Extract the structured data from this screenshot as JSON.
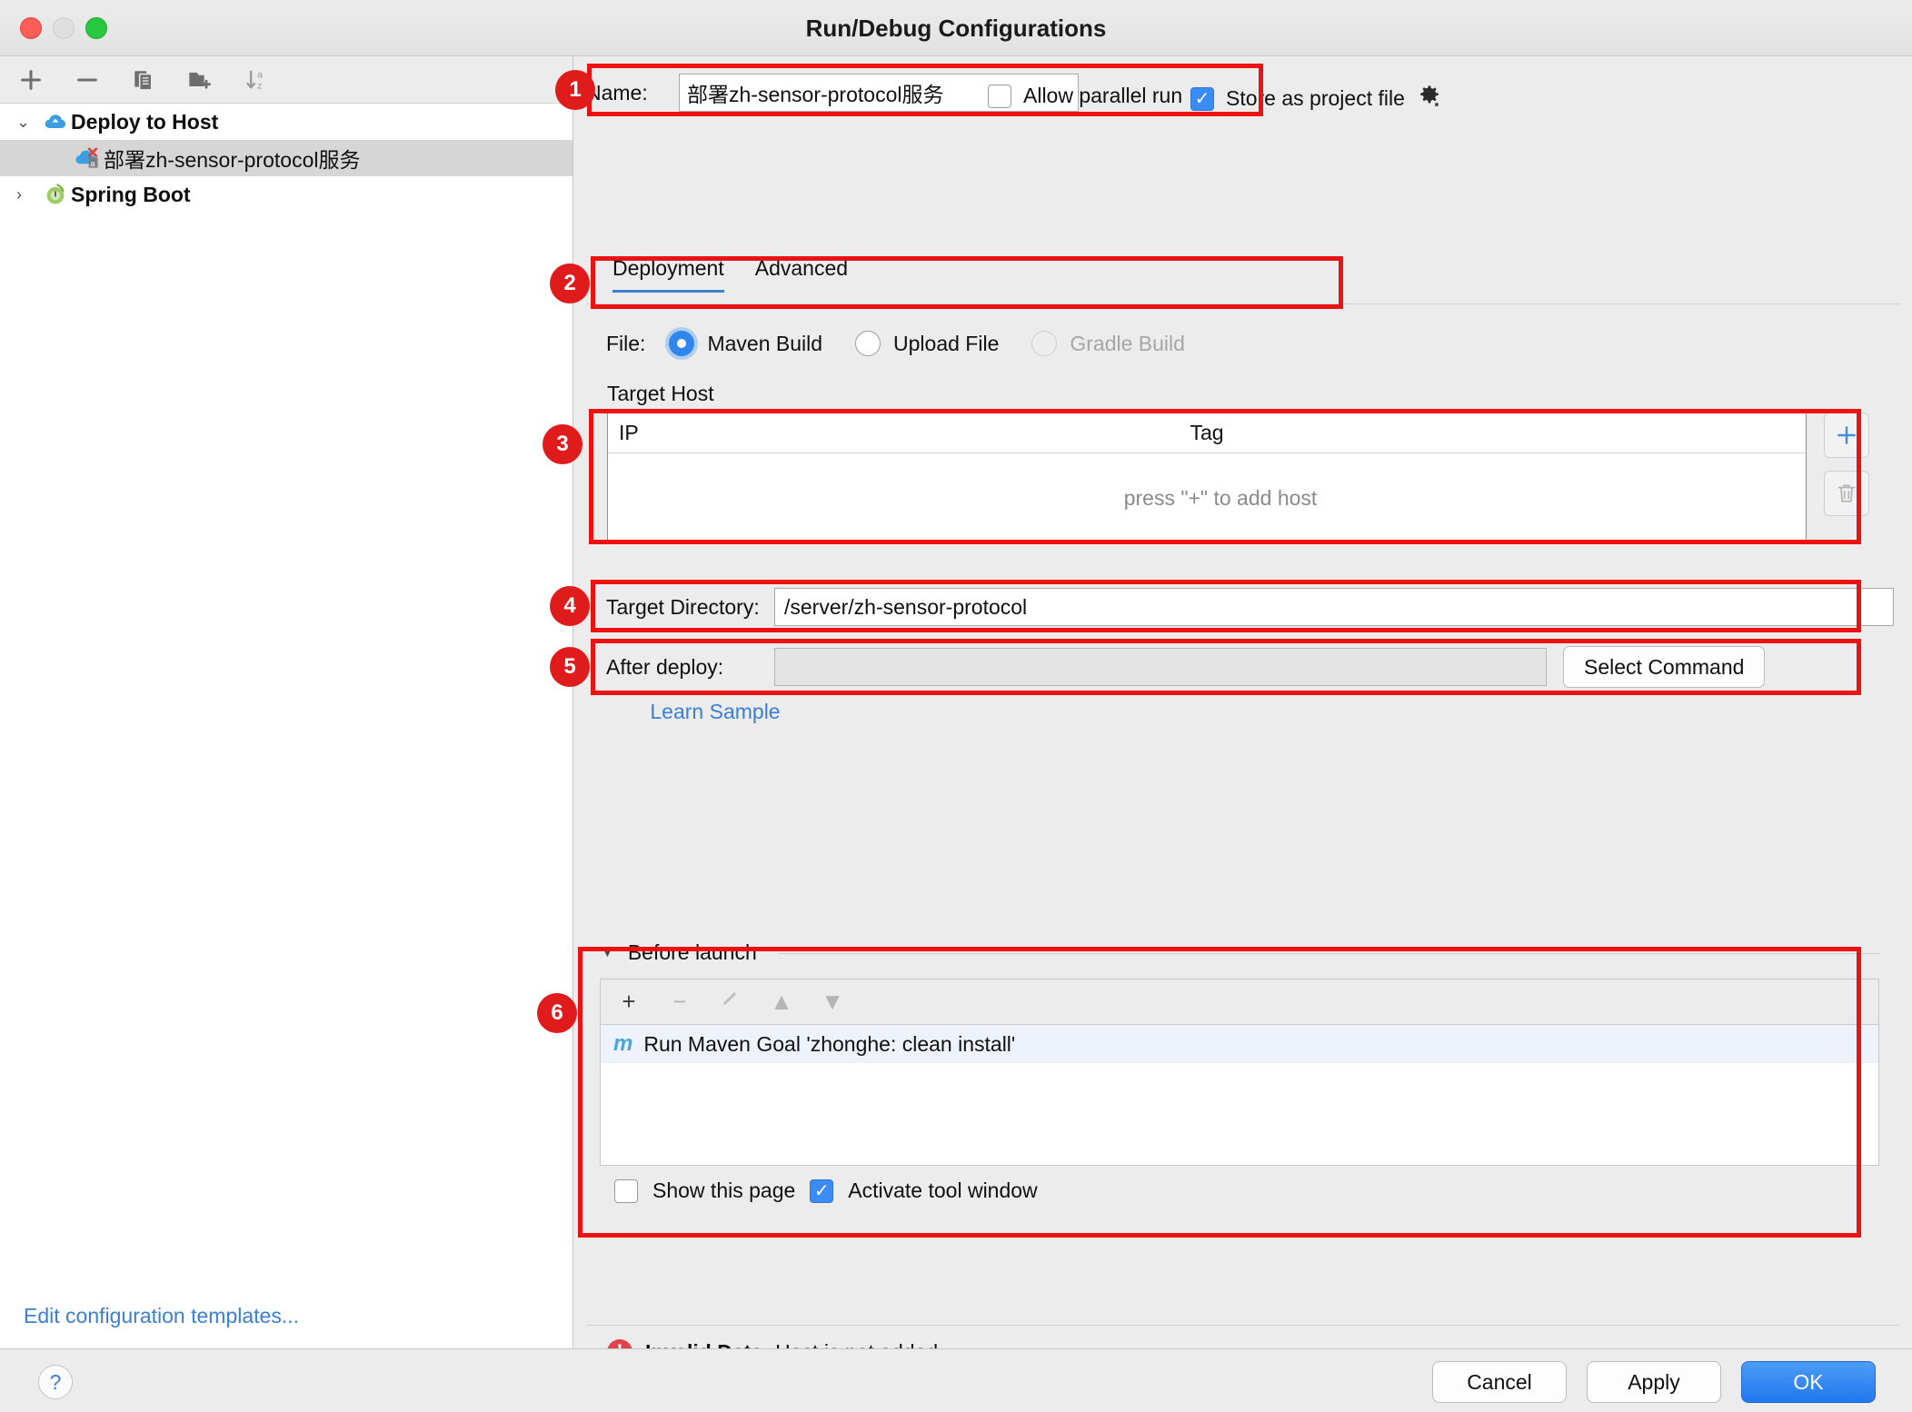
{
  "window": {
    "title": "Run/Debug Configurations",
    "traffic_lights": [
      "close",
      "minimize",
      "zoom"
    ]
  },
  "sidebar": {
    "toolbar": [
      {
        "name": "add-configuration-icon",
        "glyph": "+"
      },
      {
        "name": "remove-configuration-icon",
        "glyph": "−"
      },
      {
        "name": "copy-configuration-icon",
        "glyph": "copy"
      },
      {
        "name": "new-folder-icon",
        "glyph": "folder-plus"
      },
      {
        "name": "sort-alphabetically-icon",
        "glyph": "↓az"
      }
    ],
    "tree": [
      {
        "label": "Deploy to Host",
        "arrow": "⌄",
        "icon": "cloud-icon",
        "selected": false,
        "child": false
      },
      {
        "label": "部署zh-sensor-protocol服务",
        "arrow": "",
        "icon": "deploy-config-icon",
        "selected": true,
        "child": true
      },
      {
        "label": "Spring Boot",
        "arrow": "›",
        "icon": "spring-boot-icon",
        "selected": false,
        "child": false
      }
    ],
    "edit_templates_link": "Edit configuration templates..."
  },
  "form": {
    "name_label": "Name:",
    "name_value": "部署zh-sensor-protocol服务",
    "allow_parallel_run": {
      "label": "Allow parallel run",
      "checked": false
    },
    "store_as_project_file": {
      "label": "Store as project file",
      "checked": true,
      "gear_icon": "gear-icon"
    },
    "tabs": [
      {
        "label": "Deployment",
        "active": true
      },
      {
        "label": "Advanced",
        "active": false
      }
    ],
    "file_row": {
      "label": "File:",
      "options": [
        {
          "label": "Maven Build",
          "selected": true,
          "disabled": false
        },
        {
          "label": "Upload File",
          "selected": false,
          "disabled": false
        },
        {
          "label": "Gradle Build",
          "selected": false,
          "disabled": true
        }
      ]
    },
    "target_host": {
      "section_label": "Target Host",
      "columns": [
        "IP",
        "Tag"
      ],
      "rows": [],
      "empty_text": "press \"+\" to add host",
      "add_button": "+",
      "delete_button": "trash"
    },
    "target_directory": {
      "label": "Target Directory:",
      "value": "/server/zh-sensor-protocol"
    },
    "after_deploy": {
      "label": "After deploy:",
      "value": "",
      "select_command_button": "Select Command"
    },
    "learn_sample_link": "Learn Sample"
  },
  "before_launch": {
    "title": "Before launch",
    "collapse_arrow": "▼",
    "toolbar": [
      {
        "name": "add-task-icon",
        "glyph": "+",
        "disabled": false
      },
      {
        "name": "remove-task-icon",
        "glyph": "−",
        "disabled": true
      },
      {
        "name": "edit-task-icon",
        "glyph": "✎",
        "disabled": true
      },
      {
        "name": "move-up-icon",
        "glyph": "▲",
        "disabled": true
      },
      {
        "name": "move-down-icon",
        "glyph": "▼",
        "disabled": true
      }
    ],
    "items": [
      {
        "icon": "maven-icon",
        "icon_text": "m",
        "label": "Run Maven Goal 'zhonghe: clean install'"
      }
    ],
    "show_this_page": {
      "label": "Show this page",
      "checked": false
    },
    "activate_tool_window": {
      "label": "Activate tool window",
      "checked": true
    }
  },
  "status": {
    "error_prefix": "Invalid Data:",
    "error_message": " Host is not added",
    "error_icon": "!"
  },
  "footer": {
    "help_button": "?",
    "buttons": [
      {
        "label": "Cancel",
        "primary": false
      },
      {
        "label": "Apply",
        "primary": false
      },
      {
        "label": "OK",
        "primary": true
      }
    ]
  },
  "annotations": {
    "badges": [
      "1",
      "2",
      "3",
      "4",
      "5",
      "6"
    ]
  },
  "colors": {
    "accent_blue": "#3b8bf5",
    "link_blue": "#3a7fd5",
    "annotation_red": "#ee1111",
    "error_red": "#e0444a",
    "selected_row": "#d6d6d6"
  }
}
